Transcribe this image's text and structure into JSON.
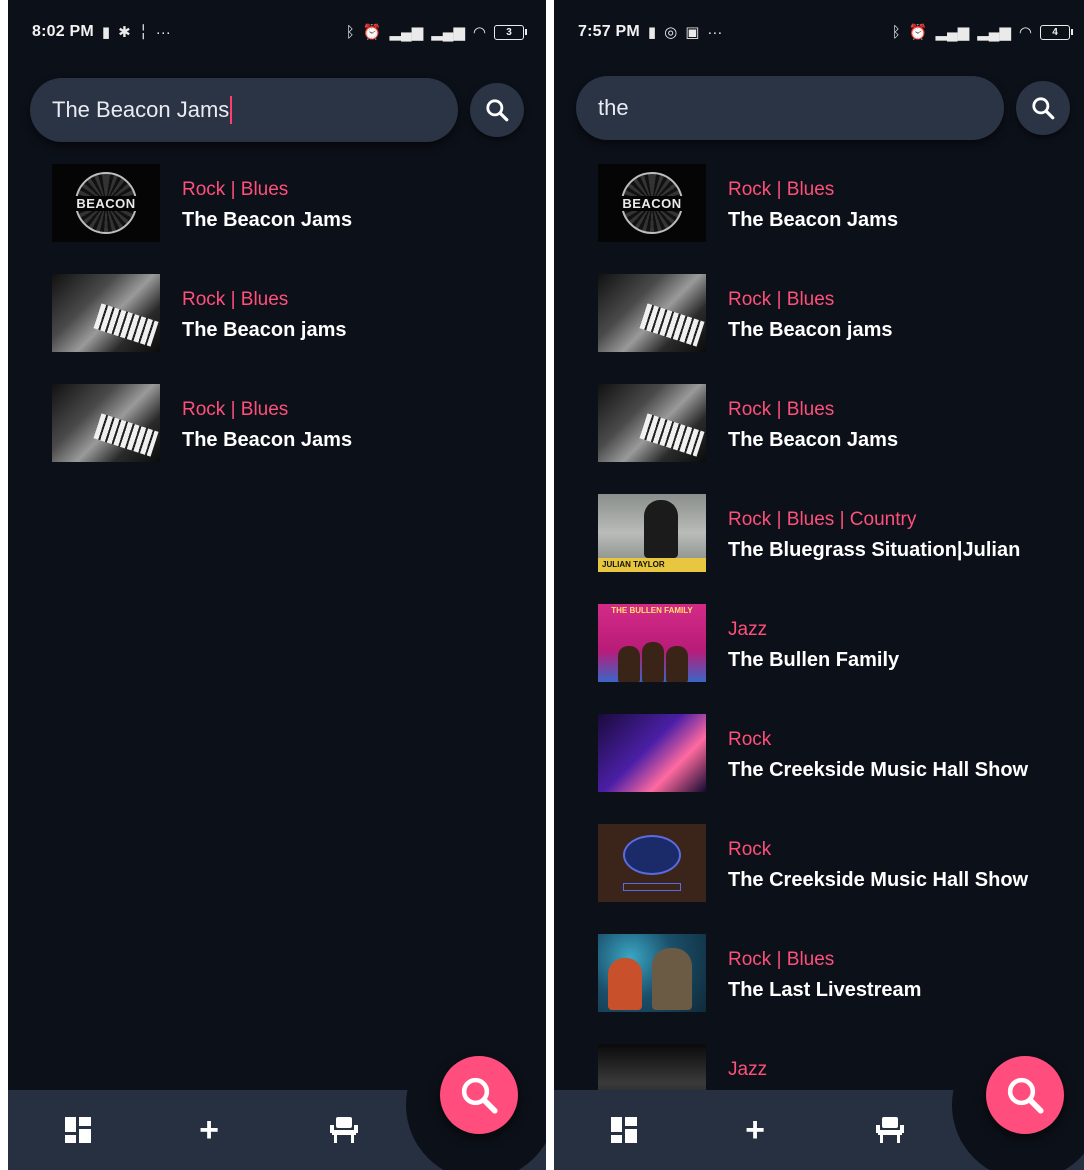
{
  "colors": {
    "background": "#0c1018",
    "accent": "#ff4d7d",
    "genre_text": "#ff4f7b",
    "surface": "#2a3444",
    "nav_bar": "#263040"
  },
  "screens": [
    {
      "status_bar": {
        "time": "8:02 PM",
        "battery": "3"
      },
      "search": {
        "value": "The Beacon Jams"
      },
      "results": [
        {
          "genre": "Rock | Blues",
          "title": "The Beacon Jams",
          "thumb": "beacon"
        },
        {
          "genre": "Rock | Blues",
          "title": "The Beacon jams",
          "thumb": "piano"
        },
        {
          "genre": "Rock | Blues",
          "title": "The Beacon Jams",
          "thumb": "piano"
        }
      ]
    },
    {
      "status_bar": {
        "time": "7:57 PM",
        "battery": "4"
      },
      "search": {
        "value": "the"
      },
      "results": [
        {
          "genre": "Rock | Blues",
          "title": "The Beacon Jams",
          "thumb": "beacon"
        },
        {
          "genre": "Rock | Blues",
          "title": "The Beacon jams",
          "thumb": "piano"
        },
        {
          "genre": "Rock | Blues",
          "title": "The Beacon Jams",
          "thumb": "piano"
        },
        {
          "genre": "Rock | Blues | Country",
          "title": "The Bluegrass Situation|Julian",
          "thumb": "julian",
          "thumb_caption": "JULIAN TAYLOR"
        },
        {
          "genre": "Jazz",
          "title": "The Bullen Family",
          "thumb": "bullen",
          "thumb_caption": "THE BULLEN FAMILY"
        },
        {
          "genre": "Rock",
          "title": "The Creekside Music Hall Show",
          "thumb": "creek1"
        },
        {
          "genre": "Rock",
          "title": "The Creekside Music Hall Show",
          "thumb": "creek2"
        },
        {
          "genre": "Rock | Blues",
          "title": "The Last Livestream",
          "thumb": "last"
        },
        {
          "genre": "Jazz",
          "title": "",
          "thumb": "jazz"
        }
      ]
    }
  ],
  "thumb_text": {
    "beacon_word": "BEACON"
  },
  "bottom_nav": {
    "items": [
      {
        "name": "dashboard-icon"
      },
      {
        "name": "add-icon",
        "label": "+"
      },
      {
        "name": "seat-icon"
      }
    ],
    "fab": "search-icon"
  }
}
